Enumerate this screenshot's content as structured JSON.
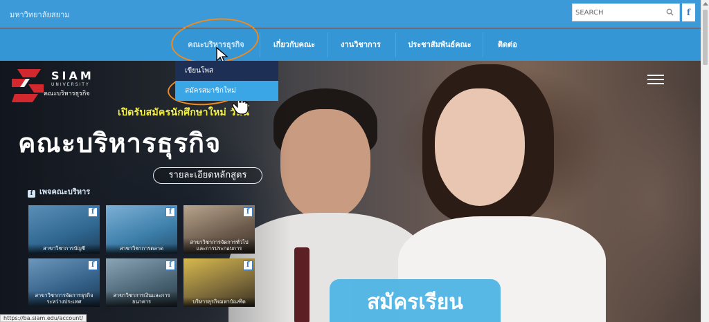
{
  "topbar": {
    "university_name": "มหาวิทยาลัยสยาม",
    "search_placeholder": "SEARCH",
    "facebook_label": "f"
  },
  "nav": {
    "items": [
      {
        "label": "คณะบริหารธุรกิจ"
      },
      {
        "label": "เกี่ยวกับคณะ"
      },
      {
        "label": "งานวิชาการ"
      },
      {
        "label": "ประชาสัมพันธ์คณะ"
      },
      {
        "label": "ติดต่อ"
      }
    ]
  },
  "dropdown": {
    "items": [
      {
        "label": "เขียนโพส"
      },
      {
        "label": "สมัครสมาชิกใหม่"
      }
    ]
  },
  "hero": {
    "logo_name": "SIAM",
    "logo_sub": "UNIVERSITY",
    "logo_faculty": "คณะบริหารธุรกิจ",
    "tagline": "เปิดรับสมัครนักศึกษาใหม่ วันนี้",
    "faculty_title": "คณะบริหารธุรกิจ",
    "detail_button": "รายละเอียดหลักสูตร",
    "fb_section_label": "เพจคณะบริหาร",
    "apply_button": "สมัครเรียน"
  },
  "thumbs": [
    {
      "caption": "สาขาวิชาการบัญชี",
      "color": "#2f6791"
    },
    {
      "caption": "สาขาวิชาการตลาด",
      "color": "#3c7ea9"
    },
    {
      "caption": "สาขาวิชาการจัดการทั่วไป และการประกอบการ",
      "color": "#6b5a4c"
    },
    {
      "caption": "สาขาวิชาการจัดการธุรกิจระหว่างประเทศ",
      "color": "#335f86"
    },
    {
      "caption": "สาขาวิชาการเงินและการธนาคาร",
      "color": "#4a6474"
    },
    {
      "caption": "บริหารธุรกิจมหาบัณฑิต",
      "color": "#7c6a3a"
    }
  ],
  "status_url": "https://ba.siam.edu/account/",
  "colors": {
    "topbar": "#3d9ad9",
    "nav": "#3596d6",
    "dropdown": "#1d2f55",
    "dropdown_hover": "#3aa6e6",
    "annotation": "#f08a1c",
    "tagline": "#f2ee4a",
    "logo_red": "#d3292e"
  },
  "icons": {
    "search": "search-icon",
    "facebook": "facebook-icon",
    "menu": "hamburger-menu-icon",
    "cursor": "pointer-cursor-icon",
    "hand": "hand-cursor-icon"
  }
}
